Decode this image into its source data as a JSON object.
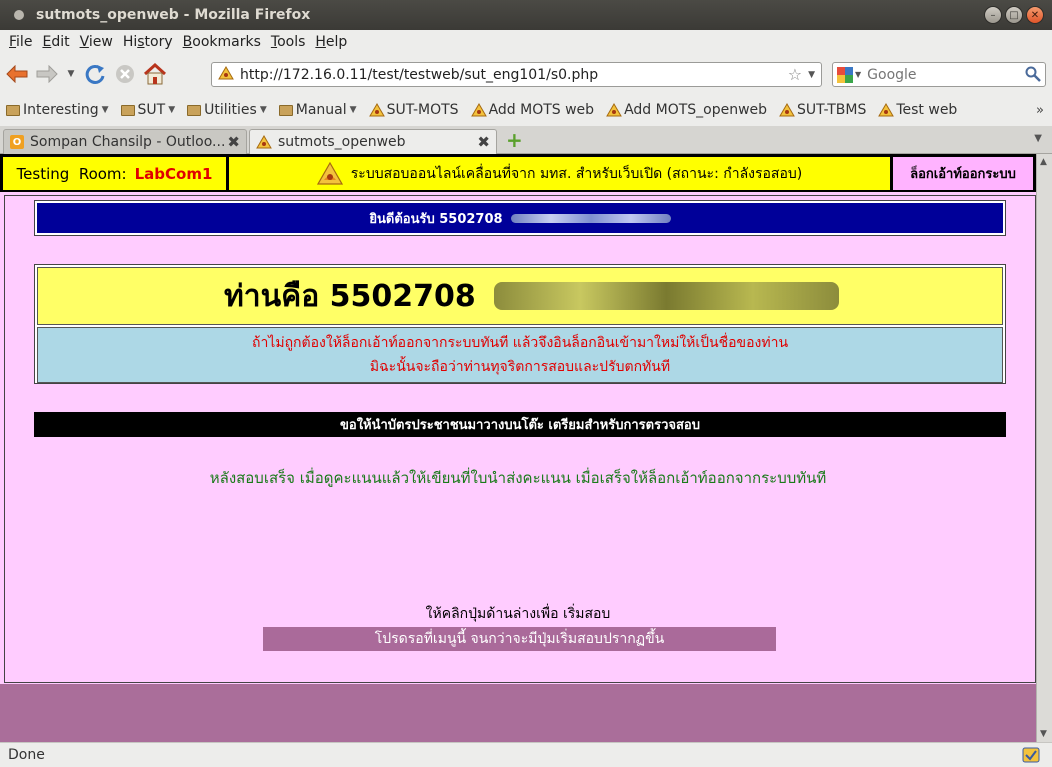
{
  "window": {
    "title": "sutmots_openweb - Mozilla Firefox"
  },
  "menu": [
    "File",
    "Edit",
    "View",
    "History",
    "Bookmarks",
    "Tools",
    "Help"
  ],
  "menu_mnemonics": [
    "F",
    "E",
    "V",
    "s",
    "B",
    "T",
    "H"
  ],
  "url": "http://172.16.0.11/test/testweb/sut_eng101/s0.php",
  "search": {
    "placeholder": "Google"
  },
  "bookmarks": [
    {
      "label": "Interesting",
      "type": "folder"
    },
    {
      "label": "SUT",
      "type": "folder"
    },
    {
      "label": "Utilities",
      "type": "folder"
    },
    {
      "label": "Manual",
      "type": "folder"
    },
    {
      "label": "SUT-MOTS",
      "type": "link"
    },
    {
      "label": "Add MOTS web",
      "type": "link"
    },
    {
      "label": "Add MOTS_openweb",
      "type": "link"
    },
    {
      "label": "SUT-TBMS",
      "type": "link"
    },
    {
      "label": "Test web",
      "type": "link"
    }
  ],
  "tabs": [
    {
      "label": "Sompan Chansilp - Outloo...",
      "active": false
    },
    {
      "label": "sutmots_openweb",
      "active": true
    }
  ],
  "status": "Done",
  "page": {
    "room_label": "Testing  Room:",
    "room_value": "LabCom1",
    "system_title": "ระบบสอบออนไลน์เคลื่อนที่จาก มทส. สำหรับเว็บเปิด (สถานะ: กำลังรอสอบ)",
    "logout": "ล็อกเอ้าท์ออกระบบ",
    "welcome": "ยินดีต้อนรับ  5502708",
    "you_are": "ท่านคือ  5502708",
    "warning_line1": "ถ้าไม่ถูกต้องให้ล็อกเอ้าท์ออกจากระบบทันที  แล้วจึงอินล็อกอินเข้ามาใหม่ให้เป็นชื่อของท่าน",
    "warning_line2": "มิฉะนั้นจะถือว่าท่านทุจริตการสอบและปรับตกทันที",
    "id_notice": "ขอให้นำบัตรประชาชนมาวางบนโต๊ะ  เตรียมสำหรับการตรวจสอบ",
    "after_exam": "หลังสอบเสร็จ  เมื่อดูคะแนนแล้วให้เขียนที่ใบนำส่งคะแนน  เมื่อเสร็จให้ล็อกเอ้าท์ออกจากระบบทันที",
    "click_below": "ให้คลิกปุ่มด้านล่างเพื่อ  เริ่มสอบ",
    "wait_button": "โปรดรอที่เมนูนี้  จนกว่าจะมีปุ่มเริ่มสอบปรากฏขึ้น"
  },
  "colors": {
    "page_bg": "#ffccff",
    "header_yellow": "#ffff00",
    "welcome_blue": "#000099",
    "room_red": "#e00000",
    "info_blue": "#add8e6",
    "footer_mauve": "#aa6e9a"
  },
  "icons": [
    "back-icon",
    "forward-icon",
    "reload-icon",
    "stop-icon",
    "home-icon",
    "bookmark-star-icon",
    "google-icon",
    "magnifier-icon",
    "new-tab-icon",
    "tab-list-icon",
    "security-icon"
  ]
}
